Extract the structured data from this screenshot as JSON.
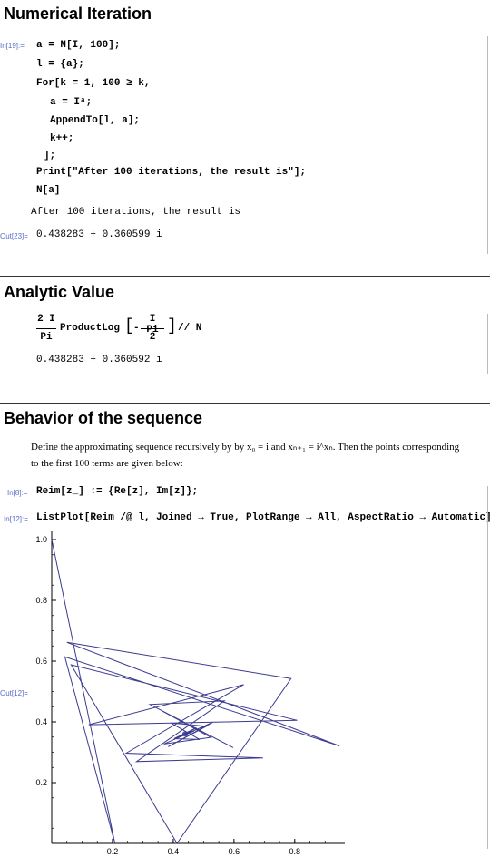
{
  "section1": {
    "title": "Numerical Iteration",
    "in_label": "In[19]:=",
    "lines": [
      "a = N[I, 100];",
      "l = {a};",
      "For[k = 1, 100 ≥ k,",
      "a = Iᵃ;",
      "AppendTo[l, a];",
      "k++;",
      "];",
      "Print[\"After 100 iterations, the result is\"];",
      "N[a]"
    ],
    "print_output": "After 100 iterations, the result is",
    "out_label": "Out[23]=",
    "result": "0.438283 + 0.360599 i"
  },
  "section2": {
    "title": "Analytic Value",
    "expr_num_left": "2 I",
    "expr_den_left": "Pi",
    "expr_func": "ProductLog",
    "expr_num_right": "I Pi",
    "expr_den_right": "2",
    "expr_tail": "// N",
    "result": "0.438283 + 0.360592 i"
  },
  "section3": {
    "title": "Behavior of the sequence",
    "text_line1": "Define the approximating sequence recursively by by x₀ = i and xₙ₊₁ = i^xₙ. Then the points corresponding",
    "text_line2": "to the first 100 terms are given below:",
    "in8_label": "In[8]:=",
    "in8_code": "Reim[z_] := {Re[z], Im[z]};",
    "in12_label": "In[12]:=",
    "in12_code": "ListPlot[Reim /@ l, Joined → True, PlotRange → All, AspectRatio → Automatic]",
    "out12_label": "Out[12]="
  },
  "chart_data": {
    "type": "line",
    "title": "",
    "xlabel": "",
    "ylabel": "",
    "xlim": [
      0,
      0.95
    ],
    "ylim": [
      0,
      1.0
    ],
    "x_ticks": [
      "0.2",
      "0.4",
      "0.6",
      "0.8"
    ],
    "y_ticks": [
      "0.2",
      "0.4",
      "0.6",
      "0.8",
      "1.0"
    ],
    "line_color": "#3b3b8f",
    "series": [
      {
        "x": [
          0,
          0.2079,
          0.0432,
          0.9472,
          0.0502,
          0.7878,
          0.4125,
          0.0639,
          0.8081,
          0.1217,
          0.6321,
          0.2451,
          0.6958,
          0.2789,
          0.5682,
          0.3231,
          0.5974,
          0.3639,
          0.5236,
          0.3693,
          0.5298,
          0.3833,
          0.5092,
          0.3917,
          0.4872,
          0.4026,
          0.4765,
          0.4121,
          0.4681,
          0.4185,
          0.4612,
          0.4243,
          0.4557,
          0.4289,
          0.4511,
          0.4328,
          0.447,
          0.4361,
          0.4437,
          0.4383,
          0.4411,
          0.439
        ],
        "y": [
          1.0,
          0,
          0.6139,
          0.3208,
          0.6618,
          0.5425,
          0.0,
          0.5881,
          0.4052,
          0.3906,
          0.5231,
          0.2969,
          0.2812,
          0.2694,
          0.4693,
          0.4573,
          0.3153,
          0.4358,
          0.3489,
          0.3271,
          0.3986,
          0.3182,
          0.3857,
          0.3967,
          0.342,
          0.3447,
          0.3806,
          0.3456,
          0.3697,
          0.351,
          0.3709,
          0.3532,
          0.3651,
          0.3555,
          0.3663,
          0.3574,
          0.3625,
          0.3584,
          0.3622,
          0.3596,
          0.3612,
          0.3603
        ]
      }
    ]
  }
}
